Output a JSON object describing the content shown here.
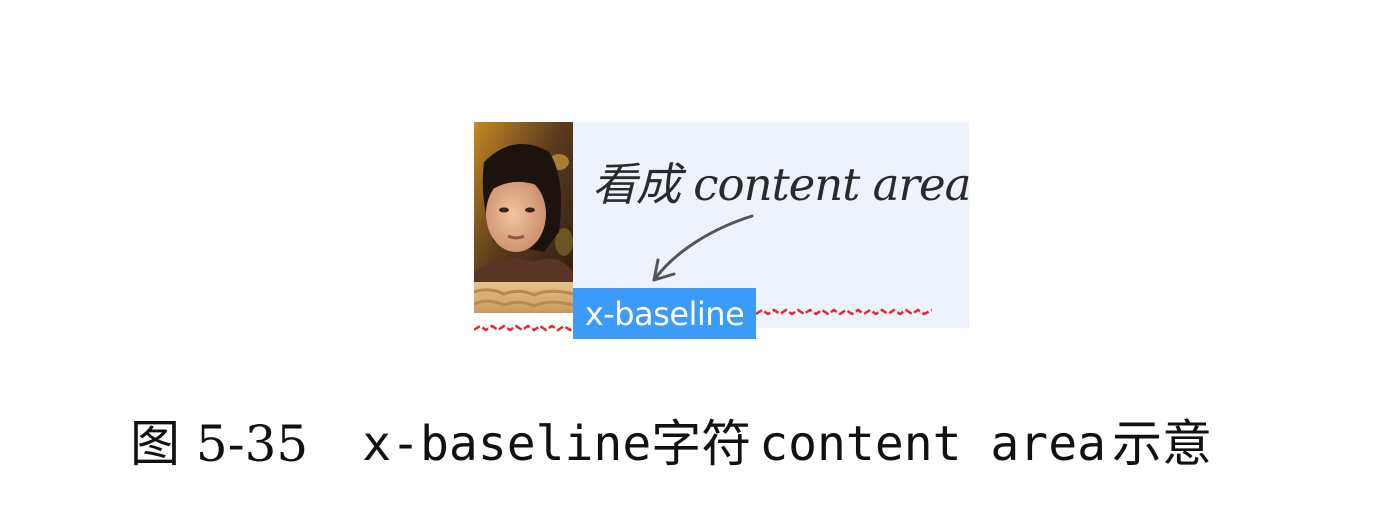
{
  "figure": {
    "handnote": "看成 content area",
    "highlight_text": "x-baseline",
    "colors": {
      "panel": "#eef2fb",
      "highlight": "#3c9af8",
      "squiggle": "#e8262b",
      "handwriting": "#2a2a2a"
    },
    "photo_icon": "portrait-photo"
  },
  "caption": {
    "label": "图 5-35",
    "code1": "x-baseline",
    "middle": "字符",
    "code2": "content area",
    "end": "示意"
  }
}
